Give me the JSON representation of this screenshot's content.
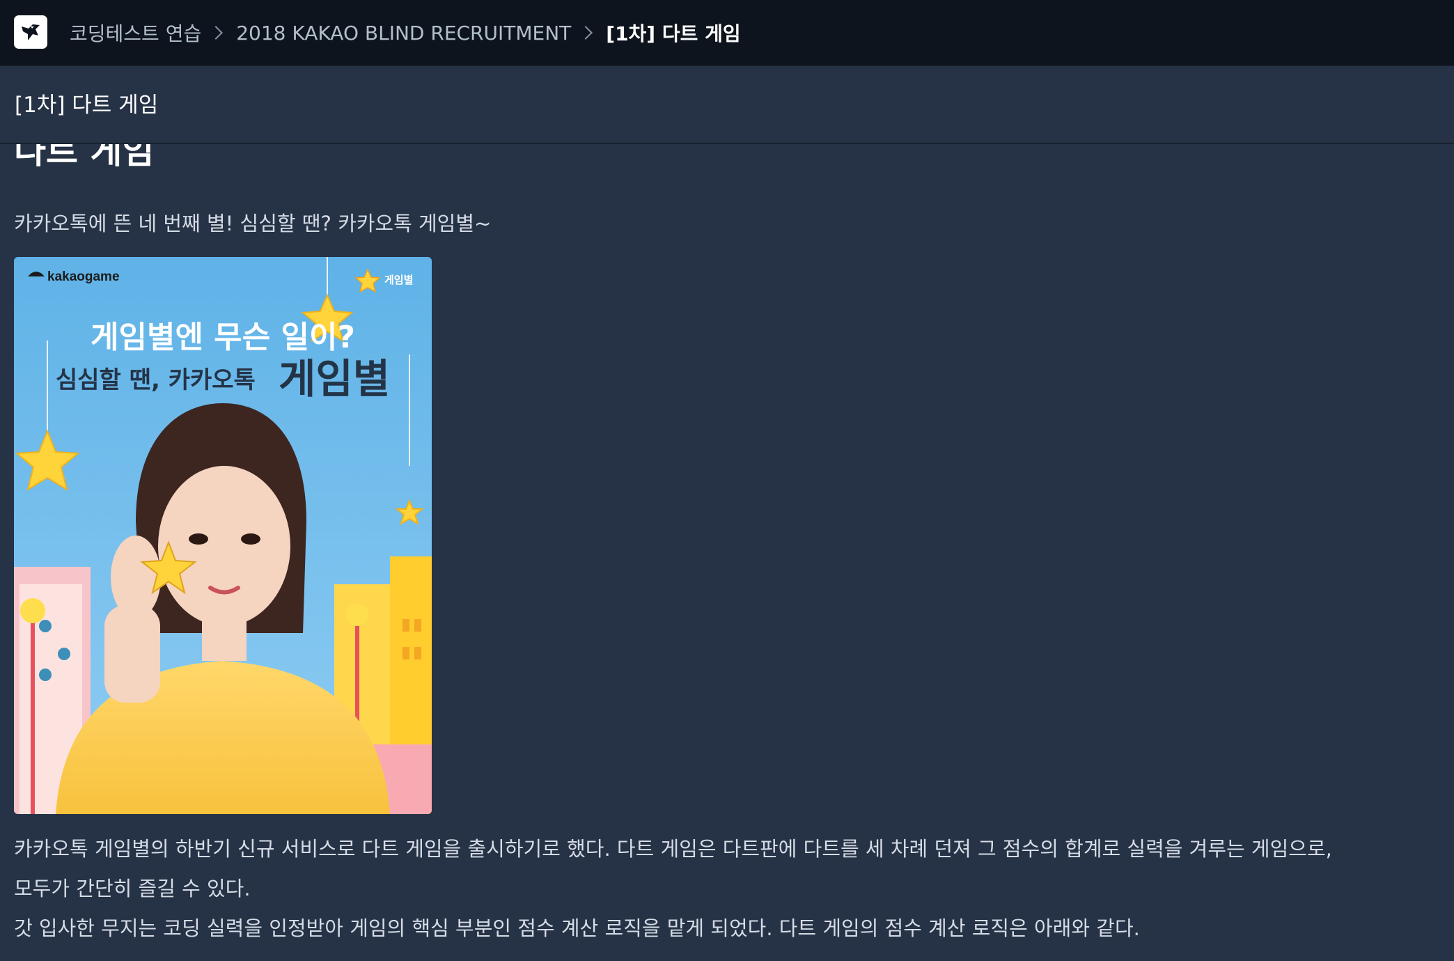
{
  "breadcrumb": {
    "items": [
      "코딩테스트 연습",
      "2018 KAKAO BLIND RECRUITMENT"
    ],
    "current": "[1차] 다트 게임"
  },
  "subheader": {
    "title": "[1차] 다트 게임"
  },
  "problem": {
    "title": "다트 게임",
    "intro": "카카오톡에 뜬 네 번째 별! 심심할 땐? 카카오톡 게임별~",
    "poster": {
      "brand": "kakaogame",
      "badge": "게임별",
      "headline": "게임별엔 무슨 일이?",
      "subline": "심심할 땐, 카카오톡",
      "subline_big": "게임별"
    },
    "paragraphs": [
      "카카오톡 게임별의 하반기 신규 서비스로 다트 게임을 출시하기로 했다. 다트 게임은 다트판에 다트를 세 차례 던져 그 점수의 합계로 실력을 겨루는 게임으로,",
      "모두가 간단히 즐길 수 있다.",
      "갓 입사한 무지는 코딩 실력을 인정받아 게임의 핵심 부분인 점수 계산 로직을 맡게 되었다. 다트 게임의 점수 계산 로직은 아래와 같다."
    ]
  },
  "colors": {
    "topbar": "#0e141e",
    "background": "#263245",
    "text": "#d5dce6",
    "poster_sky": "#6fbdee",
    "star": "#ffd43b"
  }
}
